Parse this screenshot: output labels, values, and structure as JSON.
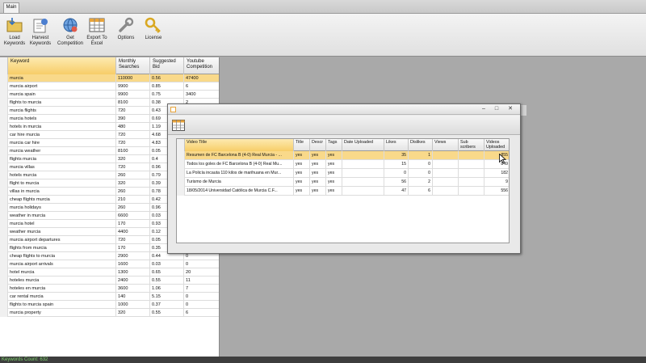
{
  "app": {
    "tab_label": "Main",
    "ribbon_buttons": [
      {
        "id": "load",
        "label": "Load Keywords",
        "icon": "folder-icon"
      },
      {
        "id": "harvest",
        "label": "Harvest Keywords",
        "icon": "harvest-icon"
      },
      {
        "id": "competition",
        "label": "Get Competition",
        "icon": "globe-icon"
      },
      {
        "id": "export",
        "label": "Export To Excel",
        "icon": "spreadsheet-icon"
      },
      {
        "id": "options",
        "label": "Options",
        "icon": "wrench-icon"
      },
      {
        "id": "license",
        "label": "License",
        "icon": "key-icon"
      }
    ],
    "colors": {
      "selection": "#f9d98a",
      "header_highlight": "#f7cd68",
      "status_text": "#7dd36d"
    }
  },
  "keywords": {
    "headers": [
      "Keyword",
      "Monthly Searches",
      "Suggested Bid",
      "Youtube Competition"
    ],
    "rows": [
      [
        "murcia",
        "110000",
        "0.56",
        "47400"
      ],
      [
        "murcia airport",
        "9900",
        "0.85",
        "6"
      ],
      [
        "murcia spain",
        "9900",
        "0.75",
        "3400"
      ],
      [
        "flights to murcia",
        "8100",
        "0.38",
        "2"
      ],
      [
        "murcia flights",
        "720",
        "0.43",
        ""
      ],
      [
        "murcia hotels",
        "390",
        "0.69",
        ""
      ],
      [
        "hotels in murcia",
        "480",
        "1.19",
        ""
      ],
      [
        "car hire murcia",
        "720",
        "4.68",
        ""
      ],
      [
        "murcia car hire",
        "720",
        "4.83",
        ""
      ],
      [
        "murcia weather",
        "8100",
        "0.05",
        ""
      ],
      [
        "flights murcia",
        "320",
        "0.4",
        ""
      ],
      [
        "murcia villas",
        "720",
        "0.96",
        ""
      ],
      [
        "hotels murcia",
        "260",
        "0.79",
        ""
      ],
      [
        "flight to murcia",
        "320",
        "0.39",
        ""
      ],
      [
        "villas in murcia",
        "260",
        "0.78",
        ""
      ],
      [
        "cheap flights murcia",
        "210",
        "0.42",
        ""
      ],
      [
        "murcia holidays",
        "260",
        "0.96",
        ""
      ],
      [
        "weather in murcia",
        "6600",
        "0.03",
        ""
      ],
      [
        "murcia hotel",
        "170",
        "0.93",
        ""
      ],
      [
        "weather murcia",
        "4400",
        "0.12",
        "3"
      ],
      [
        "murcia airport departures",
        "720",
        "0.05",
        "0"
      ],
      [
        "flights from murcia",
        "170",
        "0.35",
        "0"
      ],
      [
        "cheap flights to murcia",
        "2900",
        "0.44",
        "0"
      ],
      [
        "murcia airport arrivals",
        "1600",
        "0.03",
        "0"
      ],
      [
        "hotel murcia",
        "1300",
        "0.65",
        "20"
      ],
      [
        "hoteles murcia",
        "2400",
        "0.55",
        "11"
      ],
      [
        "hoteles en murcia",
        "3600",
        "1.06",
        "7"
      ],
      [
        "car rental murcia",
        "140",
        "5.15",
        "0"
      ],
      [
        "flights to murcia spain",
        "1000",
        "0.37",
        "0"
      ],
      [
        "murcia property",
        "320",
        "0.55",
        "6"
      ]
    ]
  },
  "status": {
    "label": "Keywords Count: 632"
  },
  "dialog": {
    "controls": {
      "minimize": "–",
      "maximize": "□",
      "close": "✕"
    },
    "headers": [
      "Video Title",
      "Title",
      "Descr",
      "Tags",
      "Date Uploaded",
      "Likes",
      "Dislikes",
      "Views",
      "Sub scribers",
      "Videos Uploaded"
    ],
    "rows": [
      [
        "Resumen de FC Barcelona B (4-0) Real Murcia - ...",
        "yes",
        "yes",
        "yes",
        "",
        "35",
        "1",
        "",
        "",
        "855"
      ],
      [
        "Todos los goles de FC Barcelona B (4-0) Real Mu...",
        "yes",
        "yes",
        "yes",
        "",
        "15",
        "0",
        "",
        "",
        "849"
      ],
      [
        "La Policía incauta 110 kilos de marihuana en Mur...",
        "yes",
        "yes",
        "yes",
        "",
        "0",
        "0",
        "",
        "",
        "182"
      ],
      [
        "Turismo de Murcia",
        "yes",
        "yes",
        "yes",
        "",
        "56",
        "2",
        "",
        "",
        "9"
      ],
      [
        "18/05/2014 Universidad Católica de Murcia C.F...",
        "yes",
        "yes",
        "yes",
        "",
        "47",
        "6",
        "",
        "",
        "556"
      ]
    ]
  }
}
